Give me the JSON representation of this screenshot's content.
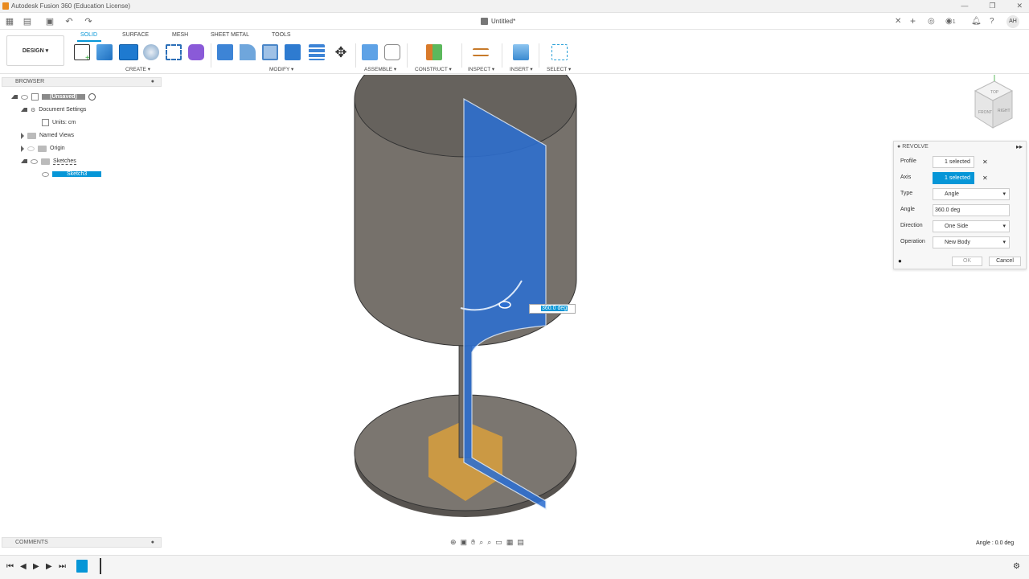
{
  "window": {
    "title": "Autodesk Fusion 360 (Education License)",
    "doc_tab": "Untitled*",
    "avatar": "AH",
    "notification_count": "1"
  },
  "ribbon": {
    "design_label": "DESIGN ▾",
    "tabs": [
      "SOLID",
      "SURFACE",
      "MESH",
      "SHEET METAL",
      "TOOLS"
    ],
    "groups": {
      "create": "CREATE ▾",
      "modify": "MODIFY ▾",
      "assemble": "ASSEMBLE ▾",
      "construct": "CONSTRUCT ▾",
      "inspect": "INSPECT ▾",
      "insert": "INSERT ▾",
      "select": "SELECT ▾"
    }
  },
  "browser": {
    "title": "BROWSER",
    "items": [
      "(Unsaved)",
      "Document Settings",
      "Units: cm",
      "Named Views",
      "Origin",
      "Sketches",
      "Sketch3"
    ]
  },
  "comments": {
    "title": "COMMENTS"
  },
  "revolve": {
    "title": "REVOLVE",
    "profile_label": "Profile",
    "profile_value": "1 selected",
    "axis_label": "Axis",
    "axis_value": "1 selected",
    "type_label": "Type",
    "type_value": "Angle",
    "angle_label": "Angle",
    "angle_value": "360.0 deg",
    "direction_label": "Direction",
    "direction_value": "One Side",
    "operation_label": "Operation",
    "operation_value": "New Body",
    "ok": "OK",
    "cancel": "Cancel"
  },
  "viewport": {
    "dimension_input": "360.0 deg",
    "angle_readout": "Angle : 0.0 deg",
    "viewcube": [
      "TOP",
      "FRONT",
      "RIGHT"
    ]
  },
  "colors": {
    "accent": "#0696d7",
    "body": "#7b7670",
    "profile": "#2d6fd1",
    "highlight": "#d9a03c"
  }
}
